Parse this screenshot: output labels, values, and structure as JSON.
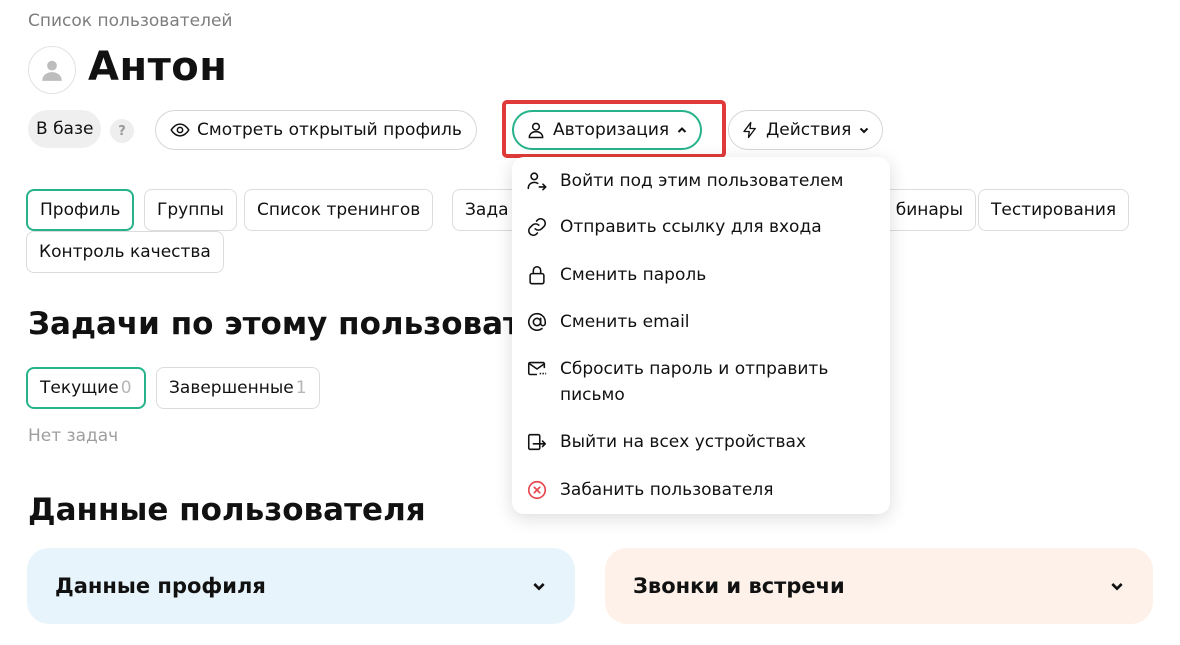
{
  "breadcrumb": "Список пользователей",
  "user": {
    "name": "Антон"
  },
  "status": {
    "label": "В базе",
    "help_icon": "?"
  },
  "buttons": {
    "view_profile": "Смотреть открытый профиль",
    "authorization": "Авторизация",
    "actions": "Действия"
  },
  "tabs": [
    {
      "label": "Профиль"
    },
    {
      "label": "Группы"
    },
    {
      "label": "Список тренингов"
    },
    {
      "label": "Зада"
    },
    {
      "label": "бинары"
    },
    {
      "label": "Тестирования"
    },
    {
      "label": "Контроль качества"
    }
  ],
  "tasks": {
    "title": "Задачи по этому пользовате",
    "tabs": [
      {
        "label": "Текущие",
        "count": "0"
      },
      {
        "label": "Завершенные",
        "count": "1"
      }
    ],
    "empty": "Нет задач"
  },
  "user_data": {
    "title": "Данные пользователя",
    "cards": [
      {
        "label": "Данные профиля"
      },
      {
        "label": "Звонки и встречи"
      }
    ]
  },
  "auth_menu": {
    "items": [
      {
        "label": "Войти под этим пользователем",
        "icon": "login-as-user-icon"
      },
      {
        "label": "Отправить ссылку для входа",
        "icon": "link-icon"
      },
      {
        "label": "Сменить пароль",
        "icon": "lock-icon"
      },
      {
        "label": "Сменить email",
        "icon": "at-sign-icon"
      },
      {
        "label": "Сбросить пароль и отправить письмо",
        "icon": "mail-reset-icon"
      },
      {
        "label": "Выйти на всех устройствах",
        "icon": "logout-devices-icon"
      },
      {
        "label": "Забанить пользователя",
        "icon": "ban-icon"
      }
    ]
  },
  "colors": {
    "accent": "#27b38a",
    "highlight": "#e03a3a",
    "danger": "#e5484d",
    "card_blue": "#e8f4fb",
    "card_peach": "#fdf1ea"
  }
}
